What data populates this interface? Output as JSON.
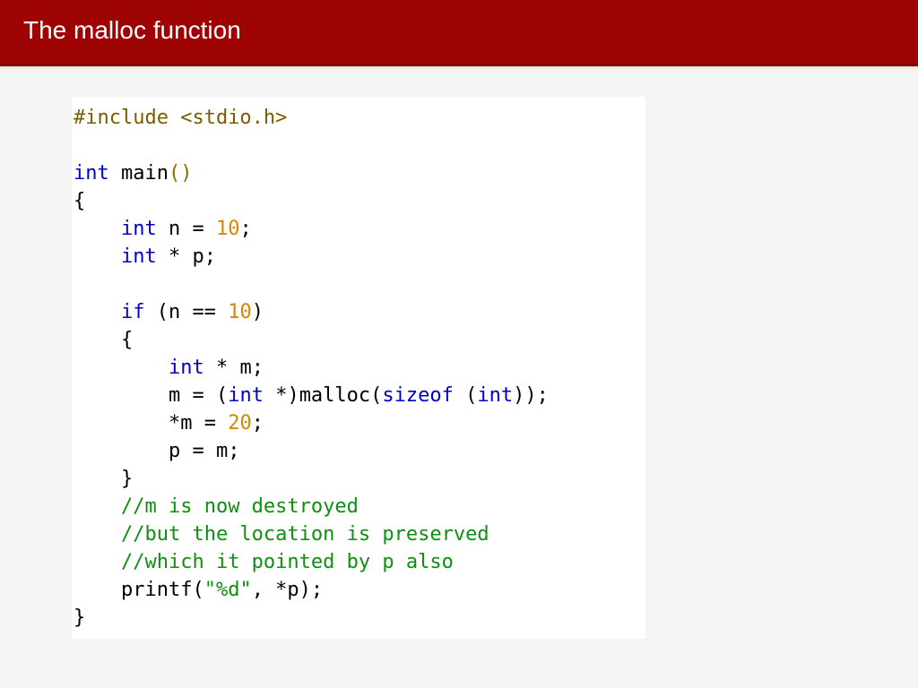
{
  "header": {
    "title": "The malloc function"
  },
  "code": {
    "l1_include": "#include <stdio.h>",
    "l3_int": "int",
    "l3_main": " main",
    "l3_paren": "()",
    "l4_brace": "{",
    "l5_int": "int",
    "l5_rest": " n = ",
    "l5_num": "10",
    "l5_semi": ";",
    "l6_int": "int",
    "l6_rest": " * p;",
    "l8_if": "if",
    "l8_open": " (n == ",
    "l8_num": "10",
    "l8_close": ")",
    "l9_brace": "{",
    "l10_int": "int",
    "l10_rest": " * m;",
    "l11_a": "m = (",
    "l11_int": "int",
    "l11_b": " *)malloc(",
    "l11_sizeof": "sizeof",
    "l11_c": " (",
    "l11_int2": "int",
    "l11_d": "));",
    "l12_a": "*m = ",
    "l12_num": "20",
    "l12_b": ";",
    "l13": "p = m;",
    "l14_brace": "}",
    "l15_comment": "//m is now destroyed",
    "l16_comment": "//but the location is preserved",
    "l17_comment": "//which it pointed by p also",
    "l18_a": "printf(",
    "l18_str": "\"%d\"",
    "l18_b": ", *p);",
    "l19_brace": "}"
  }
}
